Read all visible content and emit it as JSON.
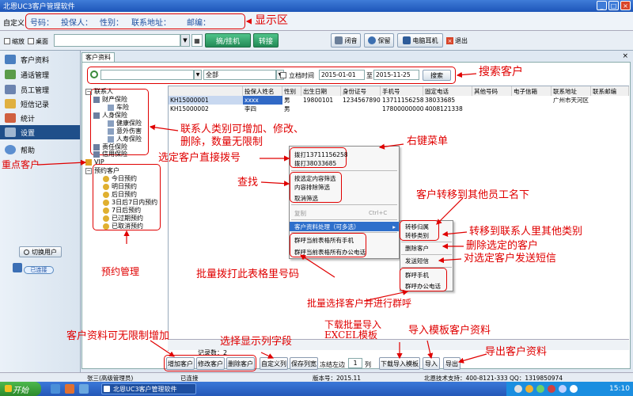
{
  "window": {
    "title": "北恩UC3客户管理软件",
    "buttons": [
      "_",
      "□",
      "×"
    ]
  },
  "infobar": {
    "custom_label": "自定义",
    "fields": [
      "号码：",
      "投保人：",
      "性别：",
      "联系地址：",
      "邮编："
    ]
  },
  "toolbar": {
    "shrink": "缩放",
    "desktop": "桌面",
    "hangup": "摘/挂机",
    "transfer": "转接",
    "mute": "闭音",
    "hold": "保留",
    "pc_headset": "电脑耳机",
    "exit": "退出"
  },
  "nav": {
    "items": [
      "客户资料",
      "通话管理",
      "员工管理",
      "短信记录",
      "统计",
      "设置",
      "帮助"
    ],
    "selected": 5,
    "switch_user": "切换用户",
    "connected": "已连接"
  },
  "tab": "客户资料",
  "search": {
    "scope": "全部",
    "archive_time": "立档时间",
    "date_from": "2015-01-01",
    "to": "至",
    "date_to": "2015-11-25",
    "button": "搜索"
  },
  "tree": {
    "root": "联系人",
    "items": [
      "财产保险",
      "车险",
      "人身保险",
      "健康保险",
      "意外伤害",
      "人寿保险",
      "责任保险",
      "信用保险"
    ],
    "vip": "VIP",
    "appt_root": "预约客户",
    "appts": [
      "今日预约",
      "明日预约",
      "后日预约",
      "3日后7日内预约",
      "7日后预约",
      "已过期预约",
      "已取消预约"
    ]
  },
  "grid": {
    "headers": [
      "",
      "投保人姓名",
      "性别",
      "出生日期",
      "身份证号",
      "手机号",
      "固定电话",
      "其他号码",
      "电子信箱",
      "联系地址",
      "联系邮编"
    ],
    "rows": [
      [
        "KH15000001",
        "xxxx",
        "男",
        "19800101",
        "1234567890",
        "13711156258",
        "38033685",
        "",
        "",
        "广州市天河区",
        ""
      ],
      [
        "KH15000002",
        "李四",
        "男",
        "",
        "",
        "17800000000",
        "4008121338",
        "",
        "",
        "",
        ""
      ]
    ],
    "record_count": "记录数：2"
  },
  "context_menu": {
    "dial": [
      "拨打13711156258",
      "拨打38033685"
    ],
    "filter": [
      "按选定内容筛选",
      "内容排除筛选",
      "取消筛选"
    ],
    "copy": "复制",
    "copy_shortcut": "Ctrl+C",
    "process": "客户资料处理（可多选）",
    "group_call": [
      "群呼当前表格所有手机",
      "群呼当前表格所有办公电话"
    ]
  },
  "sub_menu": {
    "items": [
      "转移归属",
      "转移类别",
      "删除客户",
      "发送短信",
      "群呼手机",
      "群呼办公电话"
    ]
  },
  "bottom": {
    "add": "增加客户",
    "edit": "修改客户",
    "delete": "删除客户",
    "custom_cols": "自定义列",
    "save_cols": "保存列宽",
    "freeze_left": "冻结左边",
    "freeze_n": "1",
    "col": "列",
    "download": "下载导入模板",
    "import": "导入",
    "export": "导出"
  },
  "status": {
    "user": "张三(高级管理员)",
    "conn": "已连接",
    "version": "版本号：2015.11",
    "support": "北恩技术支持：400-8121-333 QQ：1319850974"
  },
  "taskbar": {
    "start": "开始",
    "app": "北恩UC3客户管理软件",
    "time": "15:10"
  },
  "annotations": {
    "display_area": "显示区",
    "search_customer": "搜索客户",
    "category_edit_1": "联系人类别可增加、修改、",
    "category_edit_2": "删除，数量无限制",
    "key_customer": "重点客户",
    "direct_dial": "选定客户直接拨号",
    "right_menu": "右键菜单",
    "find": "查找",
    "transfer_staff": "客户转移到其他员工名下",
    "transfer_category": "转移到联系人里其他类别",
    "delete_selected": "删除选定的客户",
    "send_sms": "对选定客户发送短信",
    "appt_mgmt": "预约管理",
    "batch_dial": "批量拨打此表格里号码",
    "batch_group_call": "批量选择客户并进行群呼",
    "unlimited_add": "客户资料可无限制增加",
    "choose_cols": "选择显示列字段",
    "download_template_1": "下载批量导入",
    "download_template_2": "EXCEL模板",
    "import_template": "导入模板客户资料",
    "export_data": "导出客户资料"
  },
  "colors": {
    "accent": "#1f4f8a",
    "annotation": "#e00000",
    "green_btn": "#2fa36b"
  }
}
